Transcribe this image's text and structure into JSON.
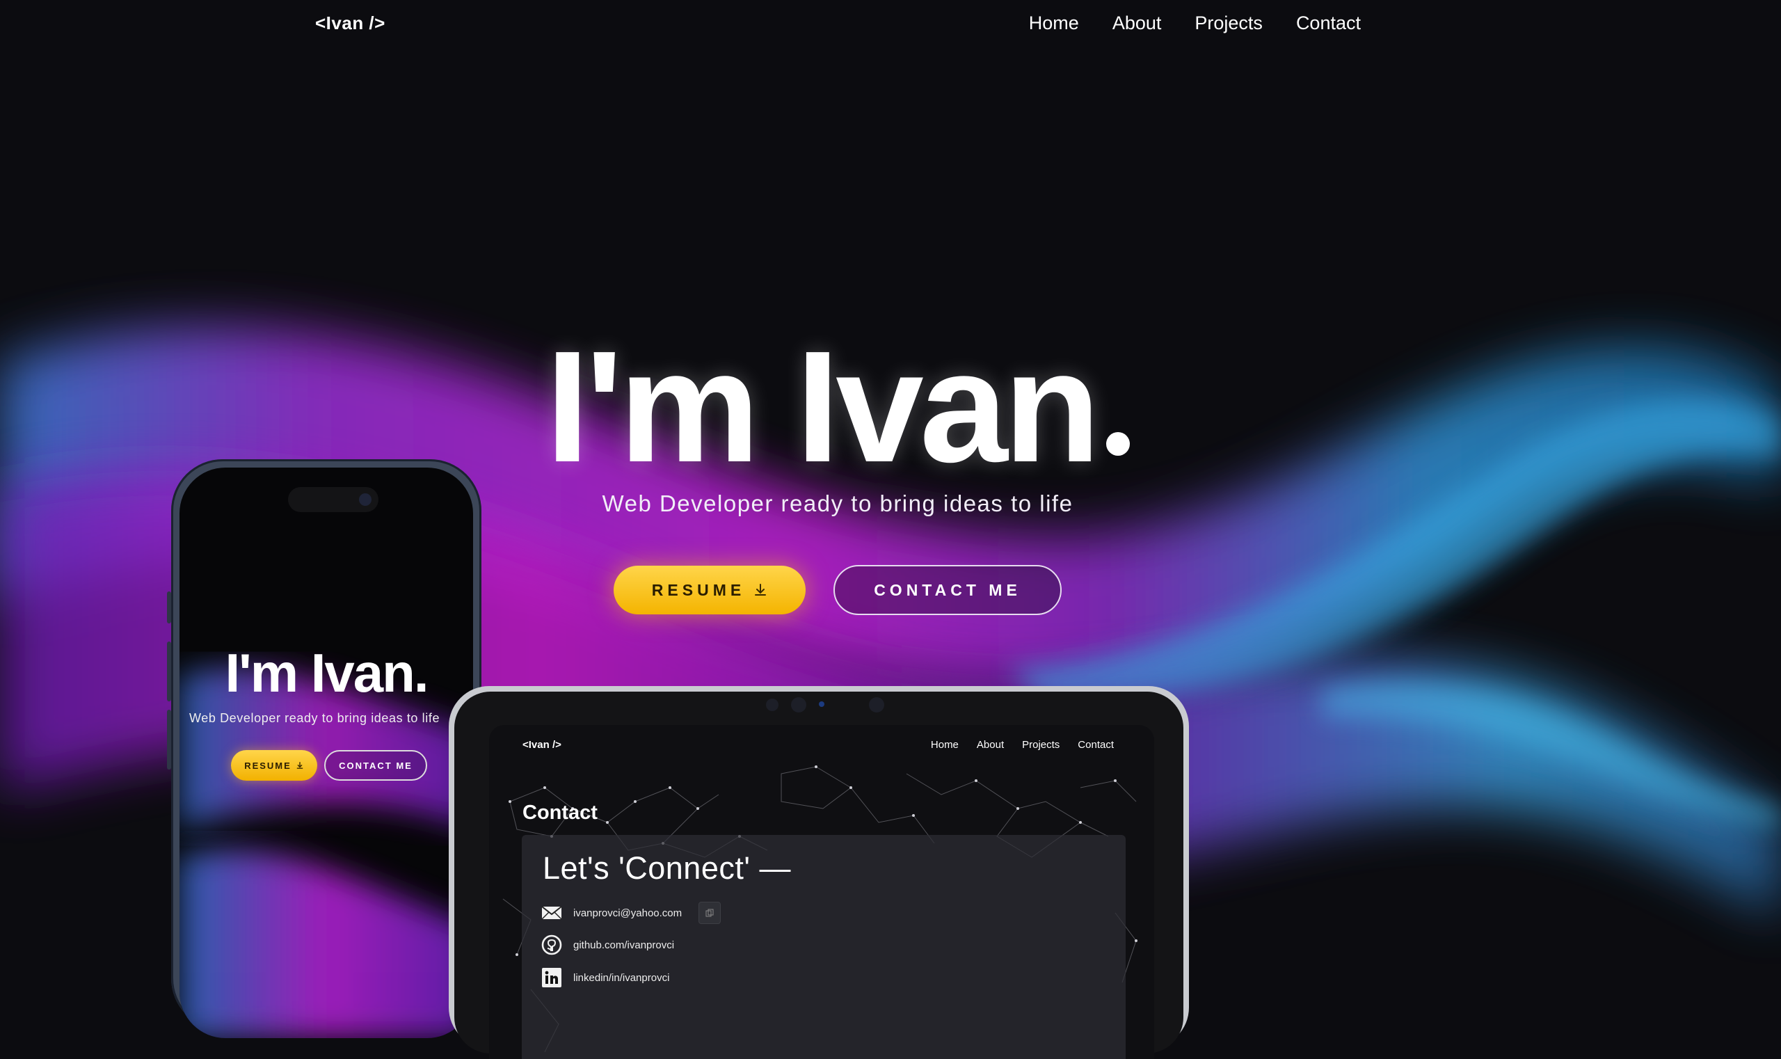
{
  "nav": {
    "logo": "<Ivan />",
    "links": [
      "Home",
      "About",
      "Projects",
      "Contact"
    ]
  },
  "hero": {
    "title": "I'm Ivan",
    "subtitle": "Web Developer ready to bring ideas to life",
    "resume_label": "RESUME",
    "contact_label": "CONTACT ME"
  },
  "phone": {
    "title": "I'm Ivan.",
    "subtitle": "Web Developer ready to bring ideas to life",
    "resume_label": "RESUME",
    "contact_label": "CONTACT ME"
  },
  "tablet": {
    "logo": "<Ivan />",
    "links": [
      "Home",
      "About",
      "Projects",
      "Contact"
    ],
    "section_heading": "Contact",
    "card_title": "Let's 'Connect' —",
    "contacts": [
      {
        "icon": "mail-icon",
        "text": "ivanprovci@yahoo.com"
      },
      {
        "icon": "github-icon",
        "text": "github.com/ivanprovci"
      },
      {
        "icon": "linkedin-icon",
        "text": "linkedin/in/ivanprovci"
      }
    ]
  },
  "colors": {
    "background": "#0c0c10",
    "accent_yellow": "#f4b400",
    "wave_purple": "#b020d0",
    "wave_blue": "#2a8fd0"
  }
}
